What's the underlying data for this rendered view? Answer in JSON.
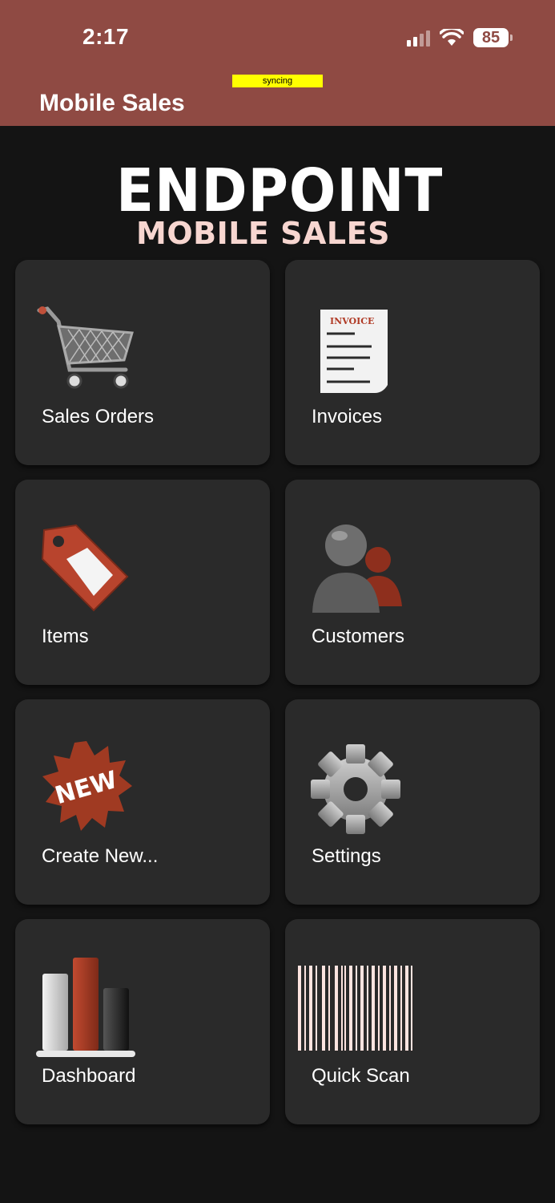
{
  "status_bar": {
    "time": "2:17",
    "battery": "85"
  },
  "header": {
    "title": "Mobile Sales",
    "sync_status": "syncing"
  },
  "logo": {
    "main": "ENDPOINT",
    "sub": "MOBILE SALES"
  },
  "tiles": [
    {
      "label": "Sales Orders",
      "icon": "shopping-cart-icon"
    },
    {
      "label": "Invoices",
      "icon": "invoice-icon",
      "icon_text": "INVOICE"
    },
    {
      "label": "Items",
      "icon": "price-tag-icon"
    },
    {
      "label": "Customers",
      "icon": "customers-icon"
    },
    {
      "label": "Create New...",
      "icon": "new-badge-icon",
      "icon_text": "NEW"
    },
    {
      "label": "Settings",
      "icon": "gear-icon"
    },
    {
      "label": "Dashboard",
      "icon": "bar-chart-icon"
    },
    {
      "label": "Quick Scan",
      "icon": "barcode-icon"
    }
  ],
  "colors": {
    "header": "#8f4a43",
    "background": "#141414",
    "tile": "#2a2a2a",
    "accent": "#a23a25",
    "sync_badge": "#ffff00"
  }
}
